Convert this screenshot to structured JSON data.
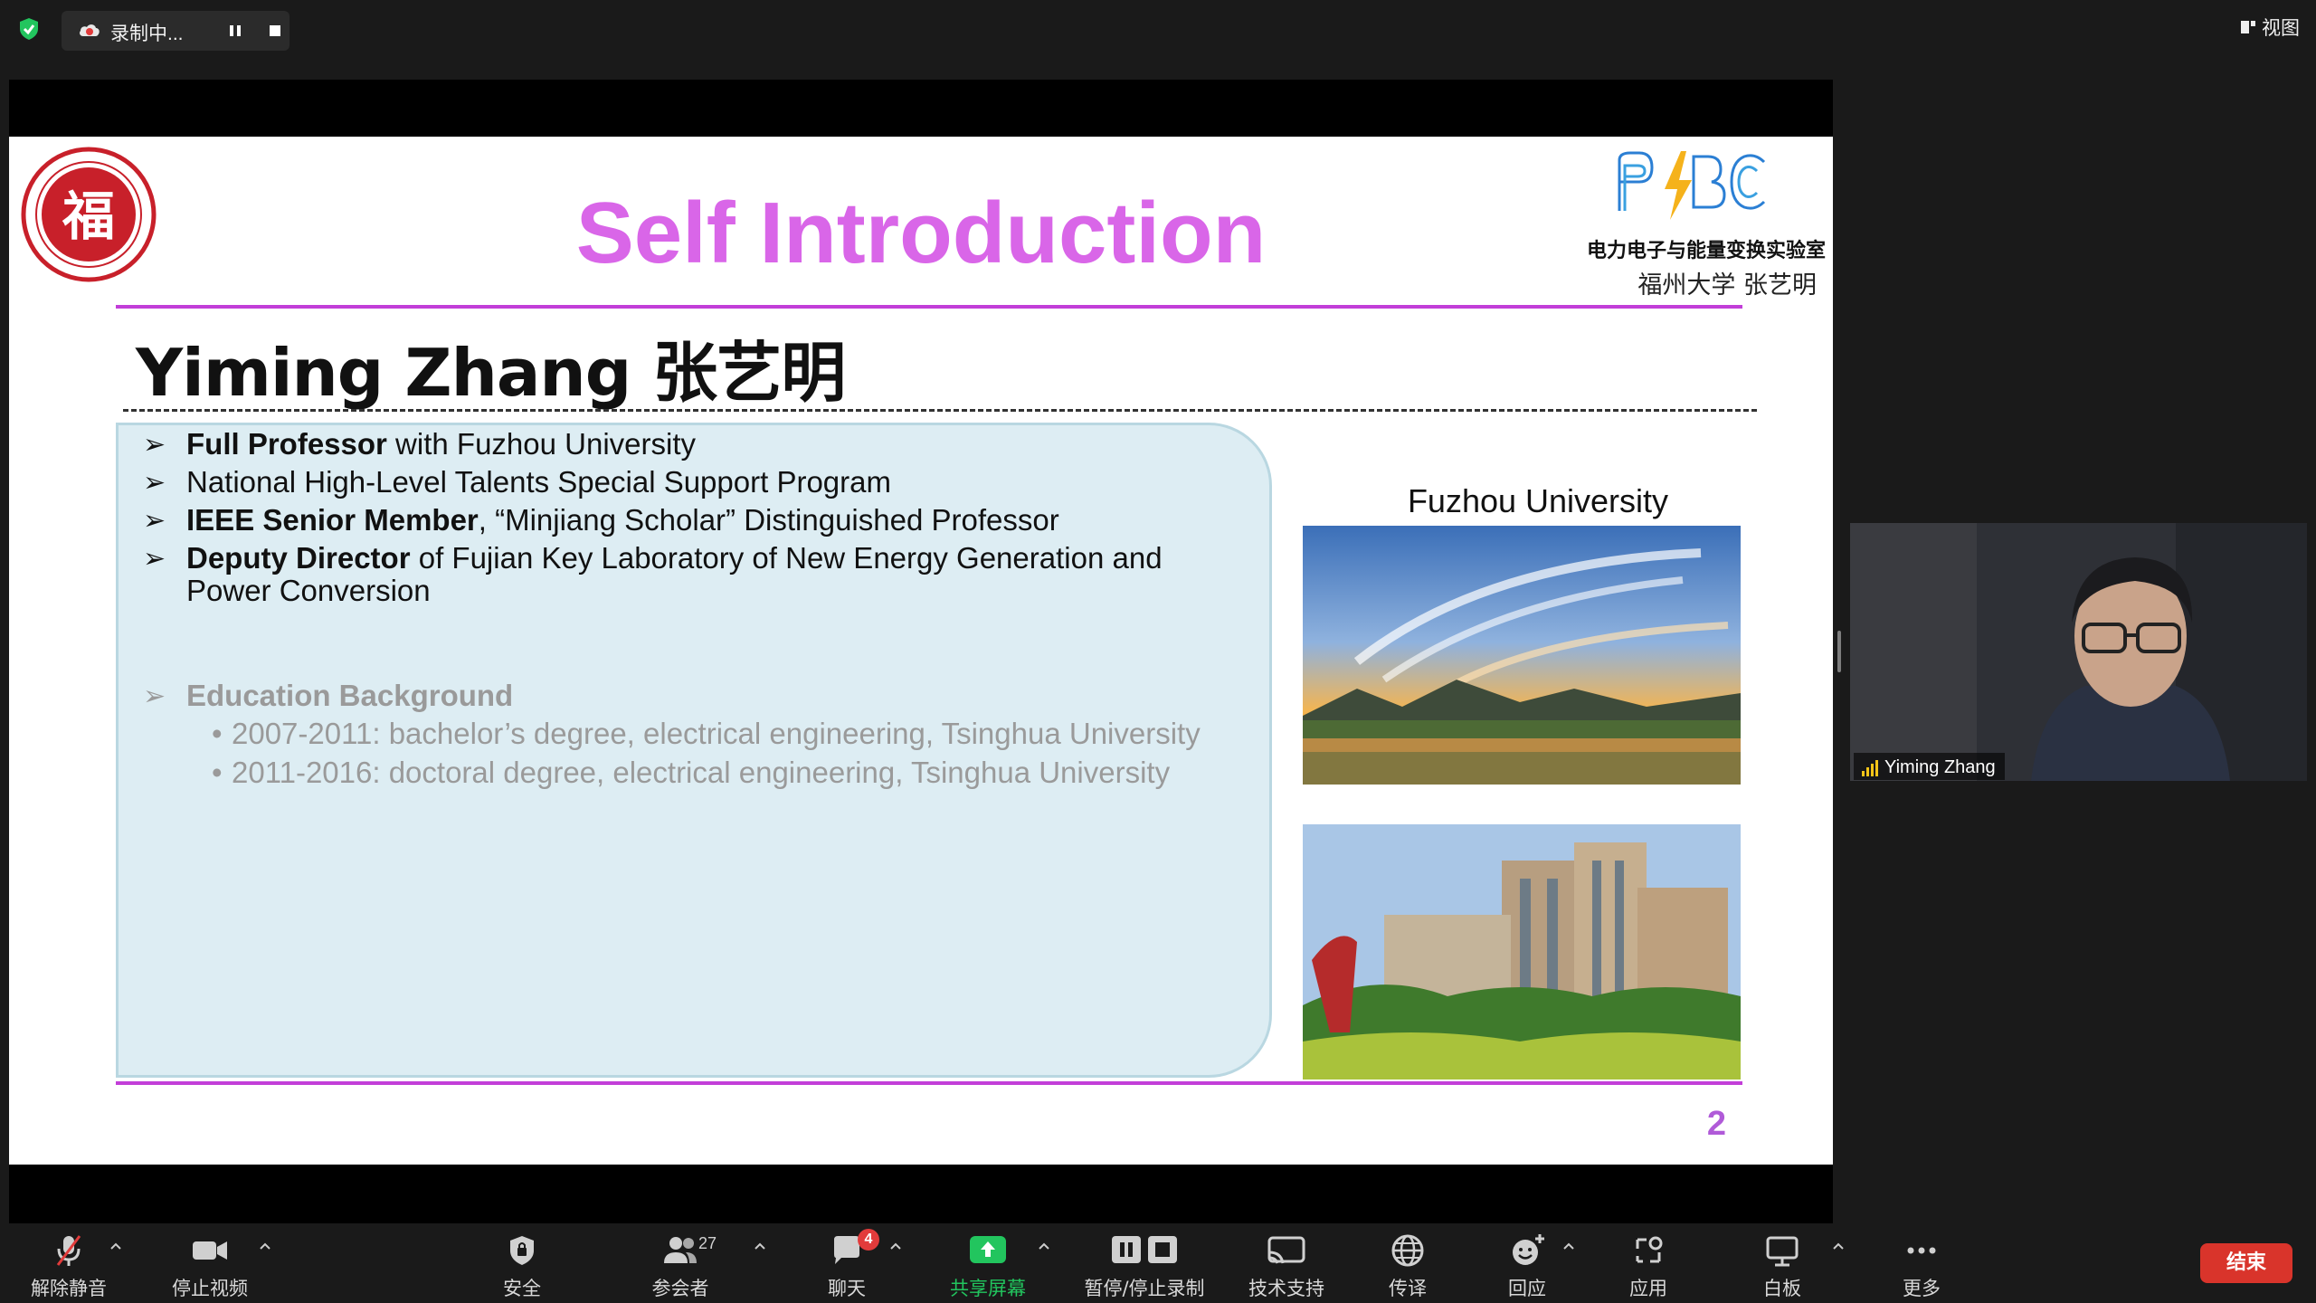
{
  "topbar": {
    "recording_label": "录制中...",
    "view_label": "视图"
  },
  "slide": {
    "title": "Self Introduction",
    "lab_name": "电力电子与能量变换实验室",
    "author_cn": "福州大学  张艺明",
    "person_name": "Yiming Zhang 张艺明",
    "bullets": [
      {
        "bold": "Full Professor",
        "rest": " with Fuzhou University"
      },
      {
        "bold": "",
        "rest": "National High-Level Talents Special Support Program"
      },
      {
        "bold": "IEEE Senior Member",
        "rest": ", “Minjiang Scholar” Distinguished Professor"
      },
      {
        "bold": "Deputy Director",
        "rest": " of Fujian Key Laboratory of New Energy Generation and Power Conversion"
      }
    ],
    "education_heading": "Education Background",
    "education": [
      "2007-2011: bachelor’s degree, electrical engineering, Tsinghua University",
      "2011-2016: doctoral degree, electrical engineering, Tsinghua University"
    ],
    "university_label": "Fuzhou University",
    "page_number": "2",
    "accent_color": "#d966e8"
  },
  "video": {
    "participant_name": "Yiming Zhang"
  },
  "toolbar": {
    "unmute": "解除静音",
    "stop_video": "停止视频",
    "security": "安全",
    "participants": "参会者",
    "participants_count": "27",
    "chat": "聊天",
    "chat_badge": "4",
    "share_screen": "共享屏幕",
    "pause_record": "暂停/停止录制",
    "support": "技术支持",
    "translate": "传译",
    "reactions": "回应",
    "apps": "应用",
    "whiteboard": "白板",
    "more": "更多",
    "end": "结束"
  }
}
